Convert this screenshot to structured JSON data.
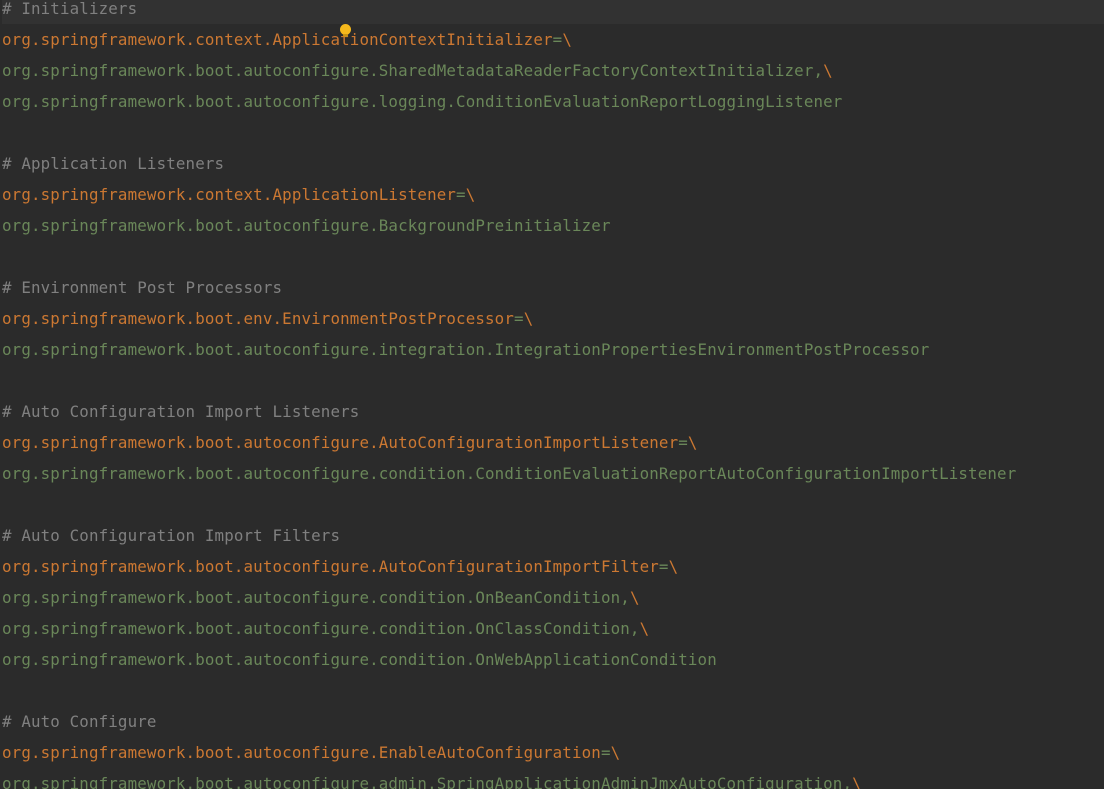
{
  "editor": {
    "lines": [
      {
        "type": "comment",
        "text": "# Initializers"
      },
      {
        "type": "key",
        "key": "org.springframework.context.ApplicationContextInitializer",
        "eq": "=",
        "bs": "\\"
      },
      {
        "type": "value",
        "text": "org.springframework.boot.autoconfigure.SharedMetadataReaderFactoryContextInitializer,",
        "bs": "\\"
      },
      {
        "type": "value",
        "text": "org.springframework.boot.autoconfigure.logging.ConditionEvaluationReportLoggingListener",
        "bs": ""
      },
      {
        "type": "blank"
      },
      {
        "type": "comment",
        "text": "# Application Listeners"
      },
      {
        "type": "key",
        "key": "org.springframework.context.ApplicationListener",
        "eq": "=",
        "bs": "\\"
      },
      {
        "type": "value",
        "text": "org.springframework.boot.autoconfigure.BackgroundPreinitializer",
        "bs": ""
      },
      {
        "type": "blank"
      },
      {
        "type": "comment",
        "text": "# Environment Post Processors"
      },
      {
        "type": "key",
        "key": "org.springframework.boot.env.EnvironmentPostProcessor",
        "eq": "=",
        "bs": "\\"
      },
      {
        "type": "value",
        "text": "org.springframework.boot.autoconfigure.integration.IntegrationPropertiesEnvironmentPostProcessor",
        "bs": ""
      },
      {
        "type": "blank"
      },
      {
        "type": "comment",
        "text": "# Auto Configuration Import Listeners"
      },
      {
        "type": "key",
        "key": "org.springframework.boot.autoconfigure.AutoConfigurationImportListener",
        "eq": "=",
        "bs": "\\"
      },
      {
        "type": "value",
        "text": "org.springframework.boot.autoconfigure.condition.ConditionEvaluationReportAutoConfigurationImportListener",
        "bs": ""
      },
      {
        "type": "blank"
      },
      {
        "type": "comment",
        "text": "# Auto Configuration Import Filters"
      },
      {
        "type": "key",
        "key": "org.springframework.boot.autoconfigure.AutoConfigurationImportFilter",
        "eq": "=",
        "bs": "\\"
      },
      {
        "type": "value",
        "text": "org.springframework.boot.autoconfigure.condition.OnBeanCondition,",
        "bs": "\\"
      },
      {
        "type": "value",
        "text": "org.springframework.boot.autoconfigure.condition.OnClassCondition,",
        "bs": "\\"
      },
      {
        "type": "value",
        "text": "org.springframework.boot.autoconfigure.condition.OnWebApplicationCondition",
        "bs": ""
      },
      {
        "type": "blank"
      },
      {
        "type": "comment",
        "text": "# Auto Configure"
      },
      {
        "type": "key",
        "key": "org.springframework.boot.autoconfigure.EnableAutoConfiguration",
        "eq": "=",
        "bs": "\\"
      },
      {
        "type": "value",
        "text": "org.springframework.boot.autoconfigure.admin.SpringApplicationAdminJmxAutoConfiguration,",
        "bs": "\\"
      }
    ]
  }
}
